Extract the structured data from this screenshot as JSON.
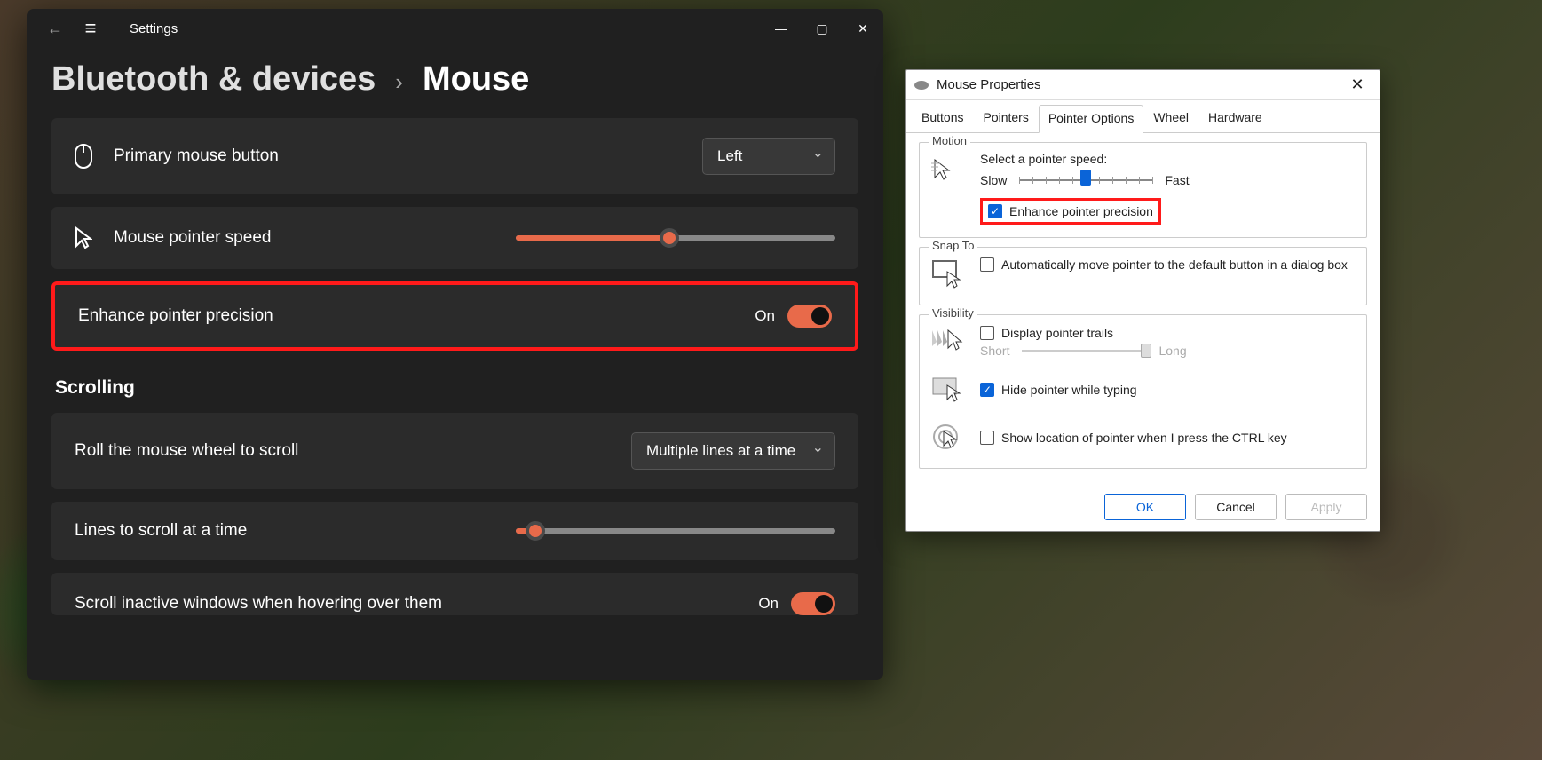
{
  "settings": {
    "app_title": "Settings",
    "breadcrumb_parent": "Bluetooth & devices",
    "breadcrumb_current": "Mouse",
    "primary_button_label": "Primary mouse button",
    "primary_button_value": "Left",
    "pointer_speed_label": "Mouse pointer speed",
    "pointer_speed_percent": 48,
    "enhance_precision_label": "Enhance pointer precision",
    "enhance_precision_state": "On",
    "scrolling_heading": "Scrolling",
    "roll_wheel_label": "Roll the mouse wheel to scroll",
    "roll_wheel_value": "Multiple lines at a time",
    "lines_scroll_label": "Lines to scroll at a time",
    "lines_scroll_percent": 6,
    "scroll_inactive_label": "Scroll inactive windows when hovering over them",
    "scroll_inactive_state": "On"
  },
  "mouse_props": {
    "title": "Mouse Properties",
    "tabs": [
      "Buttons",
      "Pointers",
      "Pointer Options",
      "Wheel",
      "Hardware"
    ],
    "active_tab": "Pointer Options",
    "motion": {
      "legend": "Motion",
      "select_speed_label": "Select a pointer speed:",
      "slow": "Slow",
      "fast": "Fast",
      "speed_pos_percent": 50,
      "ticks": 11,
      "enhance_label": "Enhance pointer precision",
      "enhance_checked": true
    },
    "snap": {
      "legend": "Snap To",
      "label": "Automatically move pointer to the default button in a dialog box",
      "checked": false
    },
    "visibility": {
      "legend": "Visibility",
      "trails_label": "Display pointer trails",
      "trails_checked": false,
      "short": "Short",
      "long": "Long",
      "hide_typing_label": "Hide pointer while typing",
      "hide_typing_checked": true,
      "show_ctrl_label": "Show location of pointer when I press the CTRL key",
      "show_ctrl_checked": false
    },
    "buttons": {
      "ok": "OK",
      "cancel": "Cancel",
      "apply": "Apply"
    }
  }
}
